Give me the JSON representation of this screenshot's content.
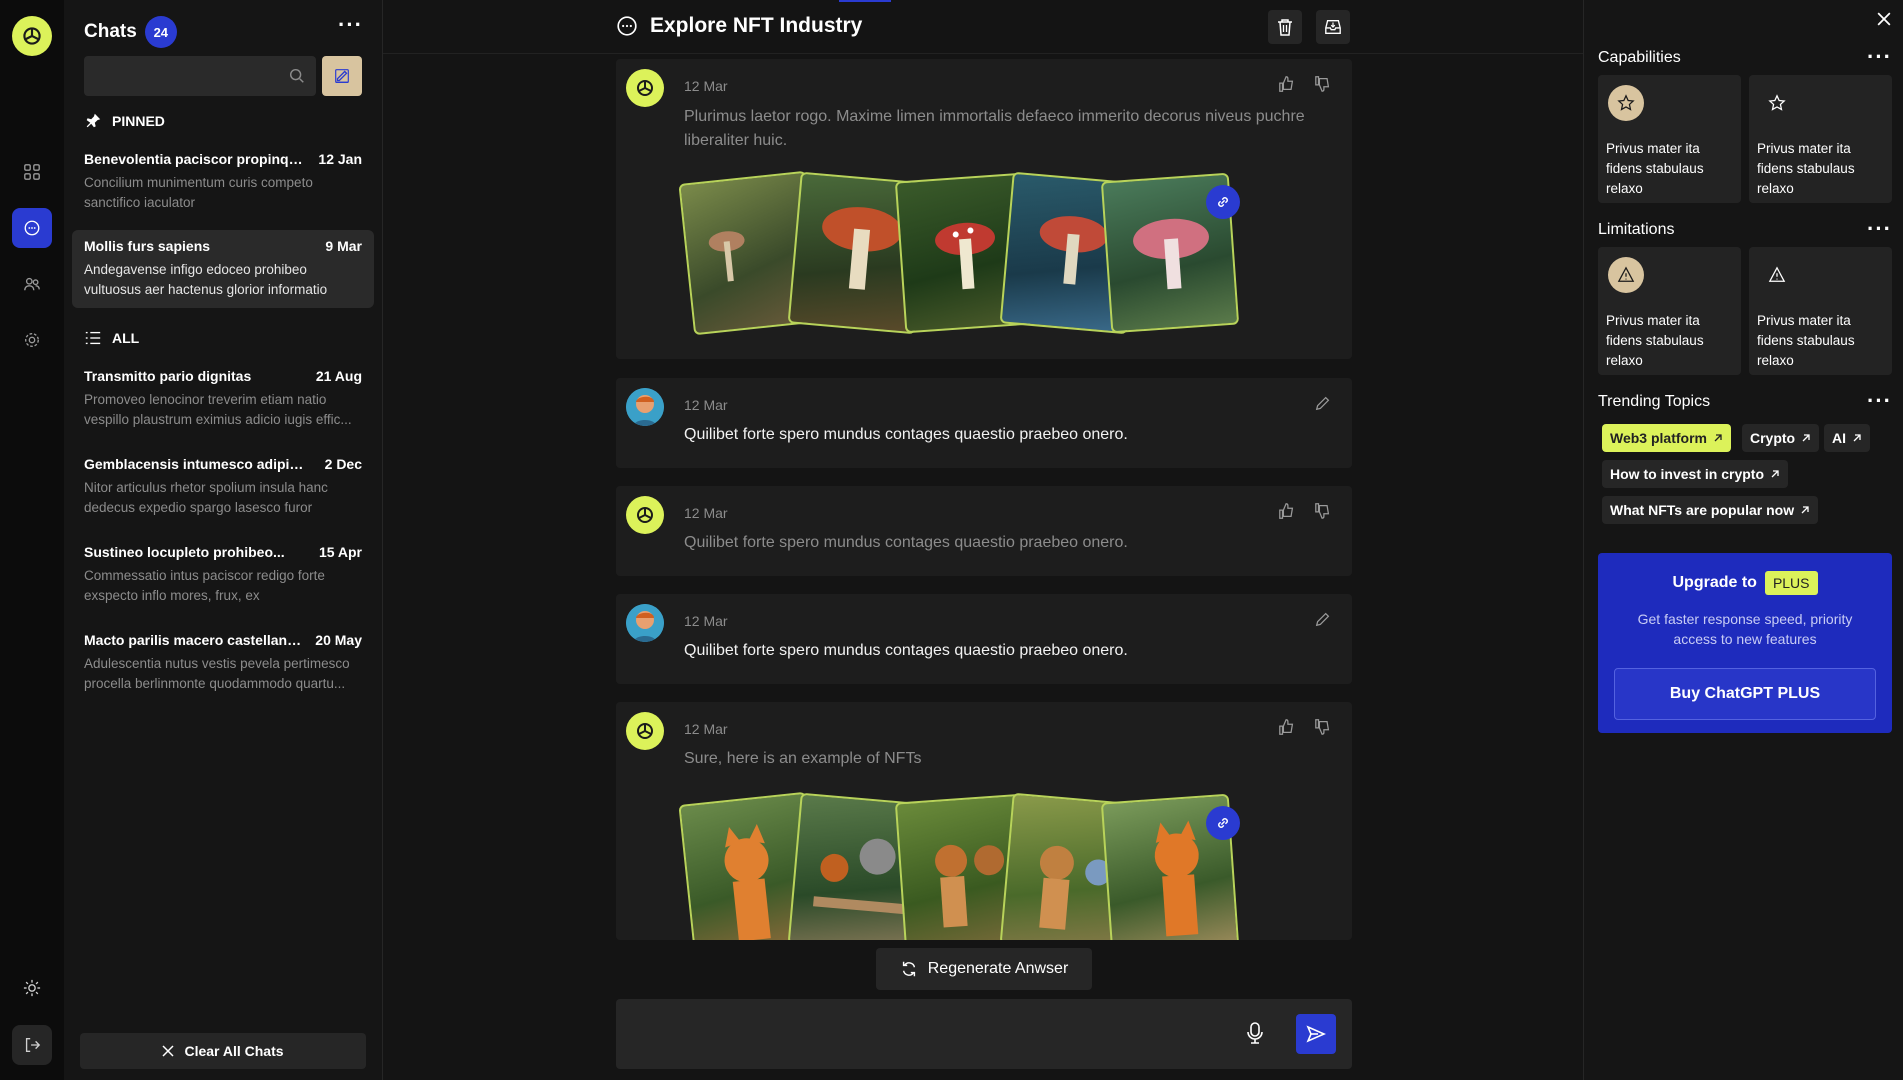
{
  "sidebar": {
    "title": "Chats",
    "count": "24",
    "search_placeholder": "",
    "pinned_label": "PINNED",
    "all_label": "ALL",
    "pinned": [
      {
        "title": "Benevolentia paciscor propinquus",
        "date": "12 Jan",
        "preview": "Concilium munimentum curis competo sanctifico iaculator"
      },
      {
        "title": "Mollis furs sapiens",
        "date": "9 Mar",
        "preview": "Andegavense infigo edoceo prohibeo vultuosus aer hactenus glorior informatio"
      }
    ],
    "all": [
      {
        "title": "Transmitto pario dignitas",
        "date": "21 Aug",
        "preview": "Promoveo lenocinor treverim etiam natio vespillo plaustrum eximius adicio iugis effic..."
      },
      {
        "title": "Gemblacensis intumesco adipiscor",
        "date": "2 Dec",
        "preview": "Nitor articulus rhetor spolium insula hanc dedecus expedio spargo lasesco furor"
      },
      {
        "title": "Sustineo locupleto prohibeo...",
        "date": "15 Apr",
        "preview": "Commessatio intus paciscor redigo forte exspecto inflo mores, frux, ex"
      },
      {
        "title": "Macto parilis macero castellandu...",
        "date": "20 May",
        "preview": "Adulescentia nutus vestis pevela pertimesco procella berlinmonte quodammodo quartu..."
      }
    ],
    "clear_label": "Clear All Chats"
  },
  "header": {
    "title": "Explore NFT Industry"
  },
  "messages": [
    {
      "date": "12 Mar",
      "text": "Plurimus laetor rogo. Maxime limen immortalis defaeco immerito decorus niveus puchre liberaliter huic."
    },
    {
      "date": "12 Mar",
      "text": "Quilibet forte spero mundus contages quaestio praebeo onero."
    },
    {
      "date": "12 Mar",
      "text": "Quilibet forte spero mundus contages quaestio praebeo onero."
    },
    {
      "date": "12 Mar",
      "text": "Quilibet forte spero mundus contages quaestio praebeo onero."
    },
    {
      "date": "12 Mar",
      "text": "Sure, here is an example of NFTs"
    }
  ],
  "regenerate_label": "Regenerate Anwser",
  "composer": {
    "placeholder": ""
  },
  "right_panel": {
    "capabilities_title": "Capabilities",
    "limitations_title": "Limitations",
    "trending_title": "Trending Topics",
    "capabilities": [
      "Privus mater ita fidens stabulaus relaxo",
      "Privus mater ita fidens stabulaus relaxo"
    ],
    "limitations": [
      "Privus mater ita fidens stabulaus relaxo",
      "Privus mater ita fidens stabulaus relaxo"
    ],
    "topics": [
      "Web3 platform",
      "Crypto",
      "AI",
      "How to invest in crypto",
      "What NFTs are popular now"
    ],
    "upgrade": {
      "label": "Upgrade to",
      "tag": "PLUS",
      "subtitle": "Get faster response speed, priority access to new features",
      "button": "Buy ChatGPT PLUS"
    }
  },
  "colors": {
    "accent": "#2a3bd1",
    "lime": "#dcf25a",
    "tan": "#d8c49f"
  }
}
